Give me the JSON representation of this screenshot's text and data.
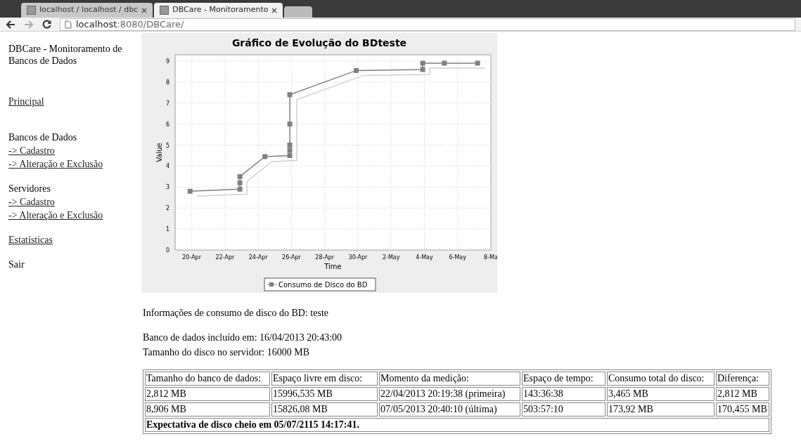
{
  "browser": {
    "tabs": [
      {
        "title": "localhost / localhost / dbc",
        "selected": false
      },
      {
        "title": "DBCare - Monitoramento",
        "selected": true
      }
    ],
    "url_host": "localhost",
    "url_path": ":8080/DBCare/"
  },
  "sidebar": {
    "title": "DBCare - Monitoramento de Bancos de Dados",
    "sections": [
      {
        "links": [
          "Principal"
        ]
      },
      {
        "heading": "Bancos de Dados",
        "links": [
          "-> Cadastro",
          "-> Alteração e Exclusão"
        ]
      },
      {
        "heading": "Servidores",
        "links": [
          "-> Cadastro",
          "-> Alteração e Exclusão"
        ]
      },
      {
        "links": [
          "Estatísticas"
        ]
      },
      {
        "heading": "Sair"
      }
    ]
  },
  "chart_data": {
    "type": "line",
    "title": "Gráfico de Evolução do BDteste",
    "xlabel": "Time",
    "ylabel": "Value",
    "x": [
      "2013-04-19T21:36",
      "2013-04-22T21:36",
      "2013-04-22T21:36",
      "2013-04-22T21:36",
      "2013-04-24T09:36",
      "2013-04-25T21:36",
      "2013-04-25T21:36",
      "2013-04-25T21:36",
      "2013-04-25T21:36",
      "2013-04-25T21:36",
      "2013-04-29T21:36",
      "2013-05-03T21:36",
      "2013-05-03T21:36",
      "2013-05-05T04:48",
      "2013-05-07T04:48"
    ],
    "grid": true,
    "series": [
      {
        "name": "Consumo de Disco do BD",
        "color": "#808080",
        "marker": "square",
        "values": [
          2.8,
          2.9,
          3.2,
          3.5,
          4.45,
          4.5,
          4.75,
          5.0,
          6.0,
          7.4,
          8.55,
          8.6,
          8.9,
          8.9,
          8.9
        ]
      }
    ],
    "xlim": [
      "2013-04-19",
      "2013-05-08"
    ],
    "ylim": [
      0,
      9.3
    ],
    "xticks": [
      {
        "value": "2013-04-20",
        "label": "20-Apr"
      },
      {
        "value": "2013-04-22",
        "label": "22-Apr"
      },
      {
        "value": "2013-04-24",
        "label": "24-Apr"
      },
      {
        "value": "2013-04-26",
        "label": "26-Apr"
      },
      {
        "value": "2013-04-28",
        "label": "28-Apr"
      },
      {
        "value": "2013-04-30",
        "label": "30-Apr"
      },
      {
        "value": "2013-05-02",
        "label": "2-May"
      },
      {
        "value": "2013-05-04",
        "label": "4-May"
      },
      {
        "value": "2013-05-06",
        "label": "6-May"
      },
      {
        "value": "2013-05-08",
        "label": "8-Ma"
      }
    ],
    "yticks": [
      0,
      1,
      2,
      3,
      4,
      5,
      6,
      7,
      8,
      9
    ]
  },
  "info": {
    "heading": "Informações de consumo de disco do BD: teste",
    "included": "Banco de dados incluído em: 16/04/2013 20:43:00",
    "disk_size": "Tamanho do disco no servidor: 16000 MB"
  },
  "table": {
    "columns": [
      "Tamanho do banco de dados:",
      "Espaço livre em disco:",
      "Momento da medição:",
      "Espaço de tempo:",
      "Consumo total do disco:",
      "Diferença:"
    ],
    "rows": [
      [
        "2,812 MB",
        "15996,535 MB",
        "22/04/2013 20:19:38 (primeira)",
        "143:36:38",
        "3,465 MB",
        "2,812 MB"
      ],
      [
        "8,906 MB",
        "15826,08 MB",
        "07/05/2013 20:40:10 (última)",
        "503:57:10",
        "173,92 MB",
        "170,455 MB"
      ]
    ],
    "footer": "Expectativa de disco cheio em 05/07/2115 14:17:41."
  }
}
